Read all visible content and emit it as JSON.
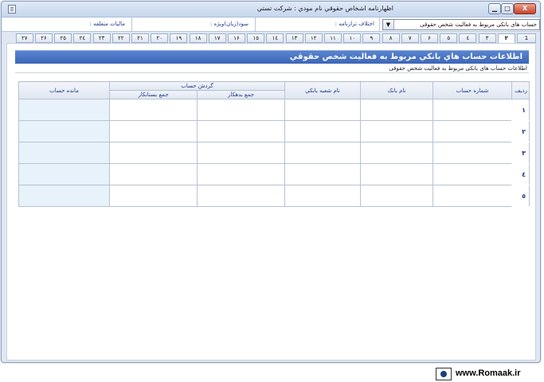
{
  "window": {
    "title": "اظهارنامه اشخاص حقوقي   نام مودي : شرکت تستي",
    "min_label": "▁",
    "max_label": "□",
    "close_label": "X"
  },
  "fields": {
    "combo_value": "حساب های بانکی مربوط به فعالیت شخص حقوقی",
    "combo_arrow": "▼",
    "diff_label": "اختلاف ترازنامه :",
    "profit_label": "سود(زيان)ويژه :",
    "tax_label": "ماليات متعلقه :"
  },
  "tabs": [
    "1",
    "٢",
    "٣",
    "٤",
    "٥",
    "۶",
    "٧",
    "٨",
    "٩",
    "١٠",
    "١١",
    "١٢",
    "١٣",
    "١٤",
    "١٥",
    "١۶",
    "١٧",
    "١٨",
    "١٩",
    "٢٠",
    "٢١",
    "٢٢",
    "٢٣",
    "٢٤",
    "٢٥",
    "٢۶",
    "٢٧"
  ],
  "active_tab": 1,
  "panel": {
    "header": "اطلاعات حساب هاي بانکي مربوط به فعاليت شخص حقوقي",
    "subheader": "اطلاعات حساب های بانکی مربوط به فعالیت شخص حقوقی"
  },
  "table": {
    "headers": {
      "row": "رديف",
      "account_number": "شماره حساب",
      "bank_name": "نام بانک",
      "branch_name": "نام شعبه بانکي",
      "turnover": "گردش حساب",
      "debit_total": "جمع بدهکار",
      "credit_total": "جمع بستانکار",
      "balance": "مانده حساب"
    },
    "rows": [
      "١",
      "٢",
      "٣",
      "٤",
      "٥"
    ]
  },
  "footer": {
    "site": "www.Romaak.ir"
  }
}
